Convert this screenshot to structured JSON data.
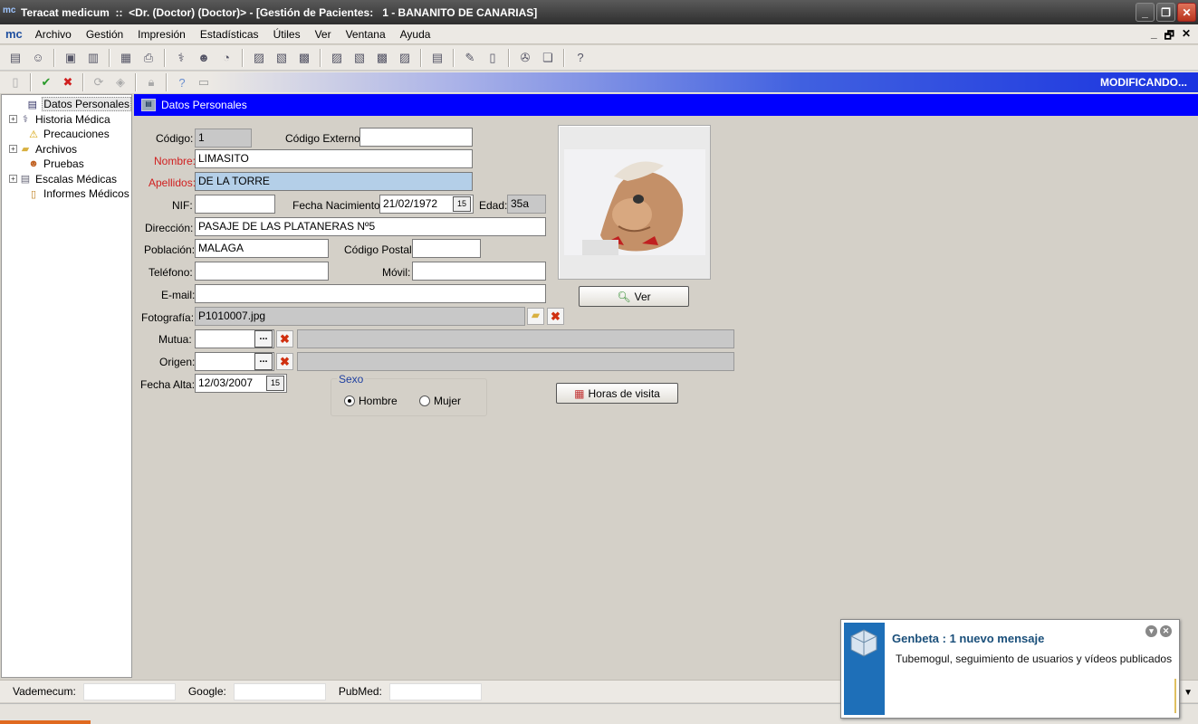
{
  "window": {
    "title": "Teracat medicum  ::  <Dr. (Doctor) (Doctor)> - [Gestión de Pacientes:   1 - BANANITO DE CANARIAS]",
    "app_icon": "mc"
  },
  "menu": {
    "logo": "mc",
    "items": [
      "Archivo",
      "Gestión",
      "Impresión",
      "Estadísticas",
      "Útiles",
      "Ver",
      "Ventana",
      "Ayuda"
    ],
    "mdi_controls": [
      "_",
      "🗗",
      "✕"
    ]
  },
  "status_banner": "MODIFICANDO...",
  "tree": {
    "items": [
      {
        "label": "Datos Personales",
        "icon": "id-card-icon",
        "expand": false,
        "selected": true
      },
      {
        "label": "Historia Médica",
        "icon": "stethoscope-icon",
        "expand": true
      },
      {
        "label": "Precauciones",
        "icon": "warning-icon",
        "expand": false
      },
      {
        "label": "Archivos",
        "icon": "folder-icon",
        "expand": true
      },
      {
        "label": "Pruebas",
        "icon": "person-icon",
        "expand": false
      },
      {
        "label": "Escalas Médicas",
        "icon": "document-icon",
        "expand": true
      },
      {
        "label": "Informes Médicos",
        "icon": "report-icon",
        "expand": false
      }
    ]
  },
  "panel": {
    "title": "Datos Personales"
  },
  "form": {
    "codigo_label": "Código:",
    "codigo_value": "1",
    "codigo_externo_label": "Código Externo:",
    "codigo_externo_value": "",
    "nombre_label": "Nombre:",
    "nombre_value": "LIMASITO",
    "apellidos_label": "Apellidos:",
    "apellidos_value": "DE LA TORRE",
    "nif_label": "NIF:",
    "nif_value": "",
    "fecha_nac_label": "Fecha Nacimiento:",
    "fecha_nac_value": "21/02/1972",
    "edad_label": "Edad:",
    "edad_value": "35a",
    "direccion_label": "Dirección:",
    "direccion_value": "PASAJE DE LAS PLATANERAS Nº5",
    "poblacion_label": "Población:",
    "poblacion_value": "MALAGA",
    "cp_label": "Código Postal:",
    "cp_value": "",
    "telefono_label": "Teléfono:",
    "telefono_value": "",
    "movil_label": "Móvil:",
    "movil_value": "",
    "email_label": "E-mail:",
    "email_value": "",
    "foto_label": "Fotografía:",
    "foto_value": "P1010007.jpg",
    "mutua_label": "Mutua:",
    "mutua_value": "",
    "origen_label": "Origen:",
    "origen_value": "",
    "fecha_alta_label": "Fecha Alta:",
    "fecha_alta_value": "12/03/2007",
    "sexo_label": "Sexo",
    "sexo_options": [
      "Hombre",
      "Mujer"
    ],
    "sexo_selected": "Hombre",
    "ver_button": "Ver",
    "horas_button": "Horas de visita",
    "cal_glyph": "15",
    "dots_glyph": "...",
    "x_glyph": "✖"
  },
  "bottom": {
    "vademecum_label": "Vademecum:",
    "google_label": "Google:",
    "pubmed_label": "PubMed:"
  },
  "notification": {
    "title": "Genbeta : 1 nuevo mensaje",
    "body": "Tubemogul, seguimiento de usuarios y vídeos publicados"
  },
  "colors": {
    "panel_header": "#0000ff",
    "required_label": "#d02020",
    "banner_end": "#1a33e0",
    "close_button": "#c0391c"
  }
}
